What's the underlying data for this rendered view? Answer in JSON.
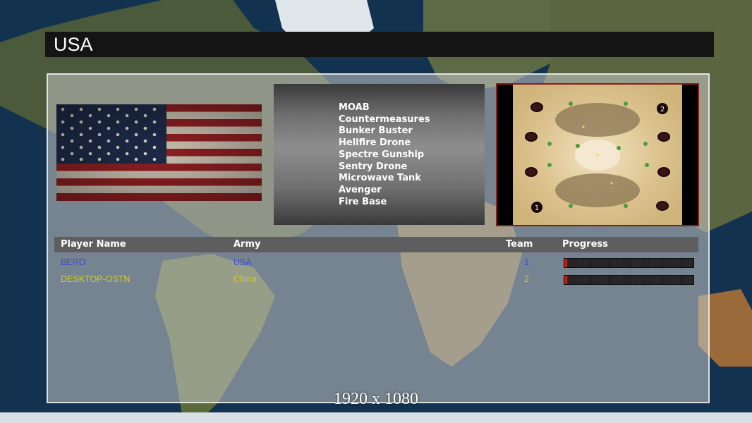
{
  "title": "USA",
  "generals_powers": [
    "MOAB",
    "Countermeasures",
    "Bunker Buster",
    "Hellfire Drone",
    "Spectre Gunship",
    "Sentry Drone",
    "Microwave Tank",
    "Avenger",
    "Fire Base"
  ],
  "minimap": {
    "start_positions": [
      "1",
      "2"
    ]
  },
  "table": {
    "headers": {
      "player_name": "Player Name",
      "army": "Army",
      "team": "Team",
      "progress": "Progress"
    },
    "players": [
      {
        "name": "BERO",
        "army": "USA",
        "team": "1",
        "color": "#3b48e0",
        "progress": 0.01
      },
      {
        "name": "DESKTOP-OSTN",
        "army": "China",
        "team": "2",
        "color": "#d4cf1a",
        "progress": 0.01
      }
    ]
  },
  "resolution_label": "1920 x 1080",
  "colors": {
    "title_bar": "#141414",
    "progress_fill": "#c41a1a",
    "minimap_border": "#8b1a1a"
  }
}
